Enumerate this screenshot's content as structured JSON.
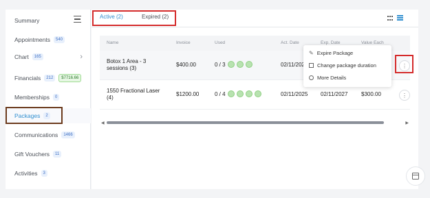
{
  "sidebar": {
    "items": [
      {
        "label": "Summary"
      },
      {
        "label": "Appointments",
        "badge": "540"
      },
      {
        "label": "Chart",
        "badge": "165"
      },
      {
        "label": "Financials",
        "badge": "212",
        "badge2": "$7716.66"
      },
      {
        "label": "Memberships",
        "badge": "0"
      },
      {
        "label": "Packages",
        "badge": "2"
      },
      {
        "label": "Communications",
        "badge": "1466"
      },
      {
        "label": "Gift Vouchers",
        "badge": "11"
      },
      {
        "label": "Activities",
        "badge": "3"
      }
    ]
  },
  "tabs": {
    "active": "Active (2)",
    "expired": "Expired (2)"
  },
  "table": {
    "headers": [
      "Name",
      "Invoice",
      "Used",
      "Act. Date",
      "Exp. Date",
      "Value Each"
    ],
    "rows": [
      {
        "name": "Botox 1 Area - 3 sessions (3)",
        "invoice": "$400.00",
        "used": "0 / 3",
        "used_total": 3,
        "act_date": "02/11/202",
        "exp_date": "",
        "value": ""
      },
      {
        "name": "1550 Fractional Laser (4)",
        "invoice": "$1200.00",
        "used": "0 / 4",
        "used_total": 4,
        "act_date": "02/11/2025",
        "exp_date": "02/11/2027",
        "value": "$300.00"
      }
    ]
  },
  "menu": {
    "items": [
      "Expire Package",
      "Change package duration",
      "More Details"
    ]
  },
  "colors": {
    "accent": "#2f8ecf",
    "highlight_red": "#d42a2a",
    "highlight_brown": "#6b3a1c",
    "session_dot": "#b8e2b0"
  }
}
